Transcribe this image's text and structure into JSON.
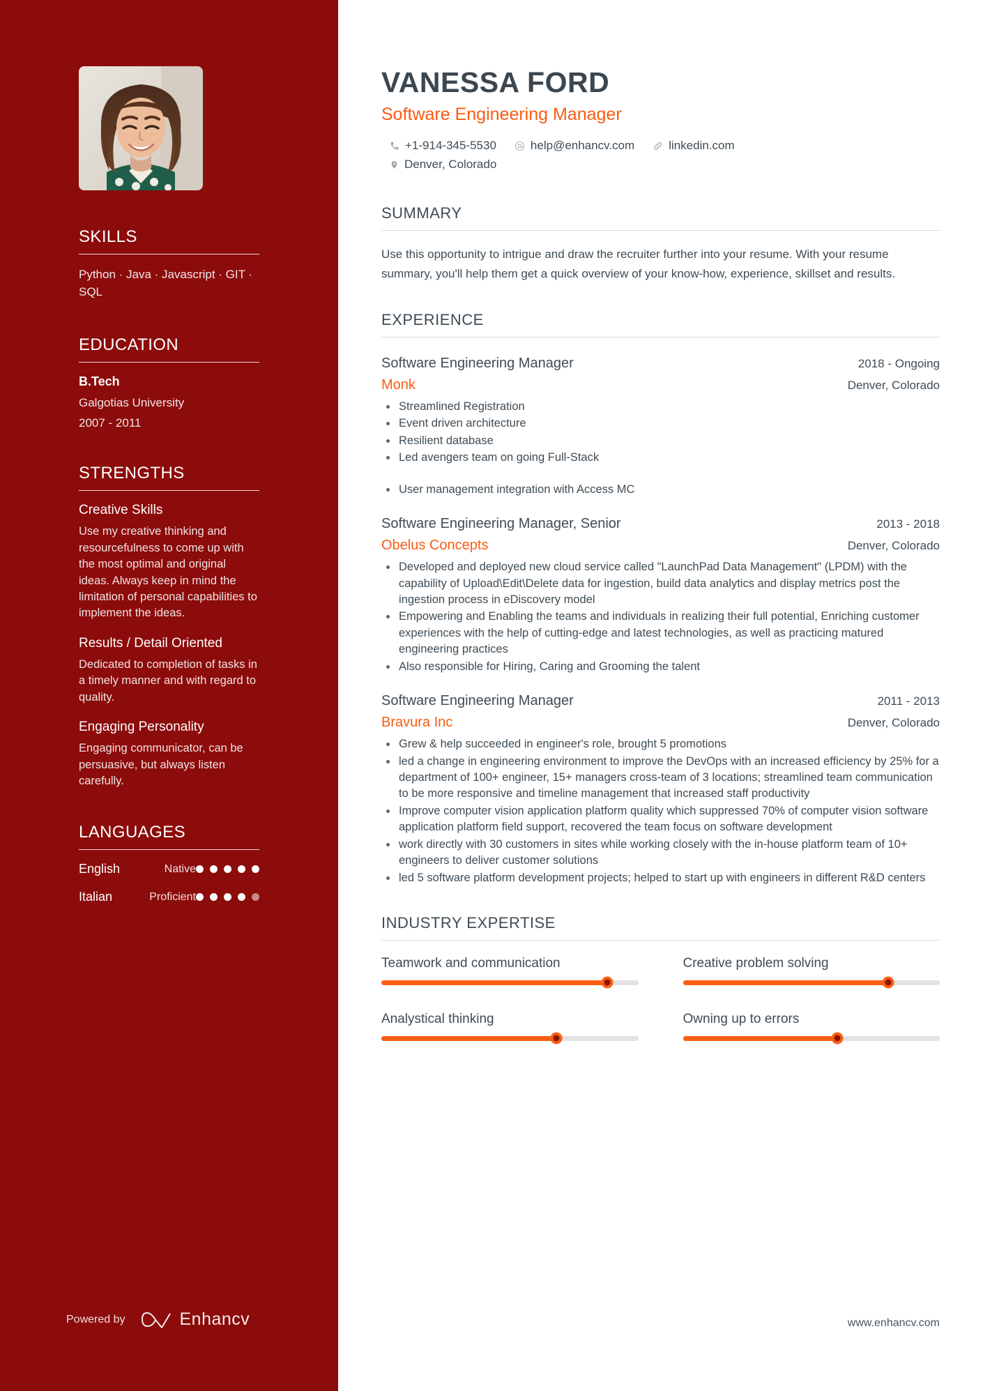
{
  "colors": {
    "sidebar_bg": "#8C0B0B",
    "accent_orange": "#FA5B12",
    "heading_slate": "#3F4C55",
    "track_gray": "#E2E2E2"
  },
  "header": {
    "name": "VANESSA FORD",
    "role": "Software Engineering Manager",
    "contacts": [
      {
        "icon": "phone-icon",
        "text": "+1-914-345-5530"
      },
      {
        "icon": "email-icon",
        "text": "help@enhancv.com"
      },
      {
        "icon": "link-icon",
        "text": "linkedin.com"
      },
      {
        "icon": "location-icon",
        "text": "Denver, Colorado"
      }
    ]
  },
  "sidebar": {
    "skills": {
      "title": "SKILLS",
      "list": "Python · Java · Javascript · GIT · SQL"
    },
    "education": {
      "title": "EDUCATION",
      "degree": "B.Tech",
      "school": "Galgotias University",
      "dates": "2007 - 2011"
    },
    "strengths": {
      "title": "STRENGTHS",
      "items": [
        {
          "name": "Creative Skills",
          "text": "Use my creative thinking and resourcefulness to come up with the most optimal and original ideas. Always keep in mind the limitation of personal capabilities to implement the ideas."
        },
        {
          "name": "Results / Detail Oriented",
          "text": "Dedicated to completion of tasks in a timely manner and with regard to quality."
        },
        {
          "name": "Engaging Personality",
          "text": "Engaging communicator, can be persuasive, but always listen carefully."
        }
      ]
    },
    "languages": {
      "title": "LANGUAGES",
      "items": [
        {
          "name": "English",
          "level": "Native",
          "filled": 5,
          "total": 5
        },
        {
          "name": "Italian",
          "level": "Proficient",
          "filled": 4,
          "total": 5
        }
      ]
    },
    "footer": {
      "powered_by": "Powered by",
      "brand": "Enhancv"
    }
  },
  "main": {
    "summary": {
      "title": "SUMMARY",
      "text": "Use this opportunity to intrigue and draw the recruiter further into your resume. With your resume summary, you'll help them get a quick overview of your know-how, experience, skillset and results."
    },
    "experience": {
      "title": "EXPERIENCE",
      "jobs": [
        {
          "title": "Software Engineering Manager",
          "date": "2018 - Ongoing",
          "company": "Monk",
          "location": "Denver, Colorado",
          "bullets": [
            "Streamlined Registration",
            "Event driven architecture",
            "Resilient database",
            "Led avengers team on going Full-Stack",
            "User management integration with Access MC"
          ],
          "gap_before_bullet_index": 4
        },
        {
          "title": "Software Engineering Manager, Senior",
          "date": "2013 - 2018",
          "company": "Obelus Concepts",
          "location": "Denver, Colorado",
          "bullets": [
            "Developed and deployed new cloud service called \"LaunchPad Data Management\" (LPDM) with the capability of Upload\\Edit\\Delete data for ingestion, build data analytics and display metrics post the ingestion process in eDiscovery model",
            "Empowering and Enabling the teams and individuals in realizing their full potential, Enriching customer experiences with the help of cutting-edge and latest technologies, as well as practicing matured engineering practices",
            "Also responsible for Hiring, Caring and Grooming the talent"
          ]
        },
        {
          "title": "Software Engineering Manager",
          "date": "2011 - 2013",
          "company": "Bravura Inc",
          "location": "Denver, Colorado",
          "bullets": [
            "Grew & help succeeded in engineer's role, brought 5 promotions",
            "led a change in engineering environment to improve the DevOps with an increased efficiency by 25% for a department of 100+ engineer, 15+ managers cross-team of 3 locations; streamlined team communication to be more responsive and timeline management that increased staff productivity",
            "Improve computer vision application platform quality which suppressed 70% of computer vision software application platform field support, recovered the team focus on software development",
            "work directly with 30 customers in sites while working closely with the in-house platform team of 10+ engineers to deliver customer solutions",
            "led 5 software platform development projects; helped to start up with engineers in different R&D centers"
          ]
        }
      ]
    },
    "industry_expertise": {
      "title": "INDUSTRY EXPERTISE",
      "items": [
        {
          "label": "Teamwork and communication",
          "value": 88
        },
        {
          "label": "Creative problem solving",
          "value": 80
        },
        {
          "label": "Analystical thinking",
          "value": 68
        },
        {
          "label": "Owning up to errors",
          "value": 60
        }
      ]
    },
    "footer": {
      "website": "www.enhancv.com"
    }
  }
}
